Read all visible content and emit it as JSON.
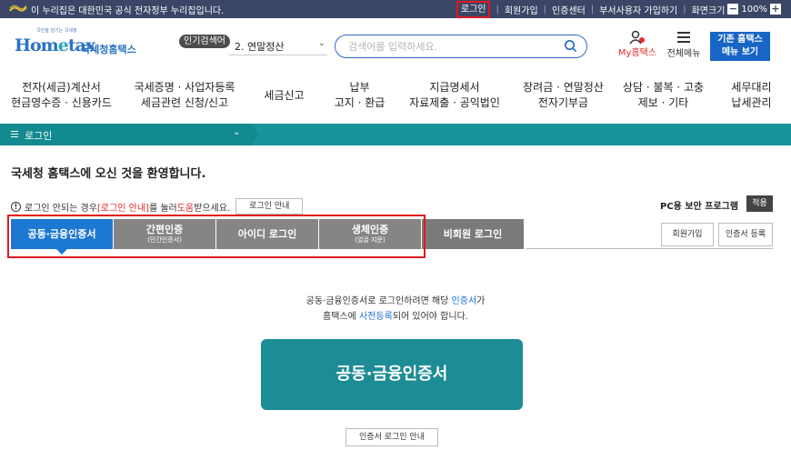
{
  "gov_strip": {
    "text": "이 누리집은 대한민국 공식 전자정부 누리집입니다.",
    "links": [
      "로그인",
      "회원가입",
      "인증센터",
      "부서사용자 가입하기",
      "화면크기"
    ],
    "zoom_minus": "−",
    "zoom_value": "100%",
    "zoom_plus": "+"
  },
  "header": {
    "logo_small": "국민을 섬기는 국세청",
    "logo_main_a": "Hom",
    "logo_main_e": "e",
    "logo_main_b": "tax",
    "logo_sub": "국세청홈택스",
    "popular_badge": "인기검색어",
    "popular_selected": "2.  연말정산",
    "search_placeholder": "검색어를 입력하세요.",
    "my_hometax": "My홈택스",
    "menu_all": "전체메뉴",
    "old_hometax_line1": "기존 홈택스",
    "old_hometax_line2": "메뉴 보기"
  },
  "nav": [
    {
      "line1": "전자(세금)계산서",
      "line2": "현금영수증 · 신용카드"
    },
    {
      "line1": "국세증명 · 사업자등록",
      "line2": "세금관련 신청/신고"
    },
    {
      "line1": "세금신고",
      "line2": ""
    },
    {
      "line1": "납부",
      "line2": "고지 · 환급"
    },
    {
      "line1": "지급명세서",
      "line2": "자료제출 · 공익법인"
    },
    {
      "line1": "장려금 · 연말정산",
      "line2": "전자기부금"
    },
    {
      "line1": "상담 · 불복 · 고충",
      "line2": "제보 · 기타"
    },
    {
      "line1": "세무대리",
      "line2": "납세관리"
    }
  ],
  "breadcrumb": {
    "label": "로그인"
  },
  "main": {
    "welcome": "국세청 홈택스에 오신 것을 환영합니다.",
    "notice_prefix": "로그인 안되는 경우 ",
    "notice_link": "[로그인 안내]",
    "notice_mid": "를 눌러 ",
    "notice_help": "도움",
    "notice_suffix": "받으세요.",
    "login_guide_btn": "로그인 안내",
    "pc_security": "PC용 보안 프로그램",
    "apply_btn": "적용"
  },
  "tabs": [
    {
      "label": "공동·금융인증서",
      "sub": ""
    },
    {
      "label": "간편인증",
      "sub": "(민간인증서)"
    },
    {
      "label": "아이디 로그인",
      "sub": ""
    },
    {
      "label": "생체인증",
      "sub": "(얼굴·지문)"
    },
    {
      "label": "비회원 로그인",
      "sub": ""
    }
  ],
  "side_buttons": {
    "join": "회원가입",
    "cert_register": "인증서 등록"
  },
  "content": {
    "line1_a": "공동·금융인증서로 로그인하려면 해당 ",
    "line1_b": "인증서",
    "line1_c": "가",
    "line2_a": "홈택스에 ",
    "line2_b": "사전등록",
    "line2_c": "되어 있어야 합니다.",
    "cert_button": "공동·금융인증서",
    "cert_guide": "인증서 로그인 안내"
  },
  "colors": {
    "gov_strip": "#3b4566",
    "brand_blue": "#1d78d3",
    "teal": "#1c8c95",
    "highlight_red": "#e0191f",
    "accent_red": "#e02828"
  }
}
